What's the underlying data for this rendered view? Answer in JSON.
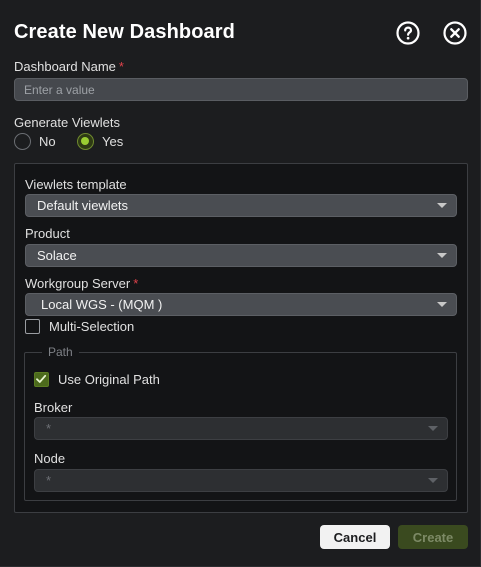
{
  "dialog": {
    "title": "Create New Dashboard",
    "help_icon": "question-circle-icon",
    "close_icon": "close-circle-icon"
  },
  "dashboard_name": {
    "label": "Dashboard Name",
    "required_mark": "*",
    "placeholder": "Enter a value",
    "value": ""
  },
  "generate_viewlets": {
    "label": "Generate Viewlets",
    "options": [
      {
        "label": "No",
        "selected": false
      },
      {
        "label": "Yes",
        "selected": true
      }
    ]
  },
  "viewlets_template": {
    "label": "Viewlets template",
    "value": "Default viewlets"
  },
  "product": {
    "label": "Product",
    "value": "Solace"
  },
  "workgroup_server": {
    "label": "Workgroup Server",
    "required_mark": "*",
    "value": "Local WGS - (MQM )"
  },
  "multi_selection": {
    "label": "Multi-Selection",
    "checked": false
  },
  "path": {
    "legend": "Path",
    "use_original_path": {
      "label": "Use Original Path",
      "checked": true
    },
    "broker": {
      "label": "Broker",
      "value": "*"
    },
    "node": {
      "label": "Node",
      "value": "*"
    }
  },
  "footer": {
    "cancel_label": "Cancel",
    "create_label": "Create"
  },
  "colors": {
    "accent": "#9acd32",
    "required": "#e0424b",
    "background": "#1c1d1f"
  }
}
